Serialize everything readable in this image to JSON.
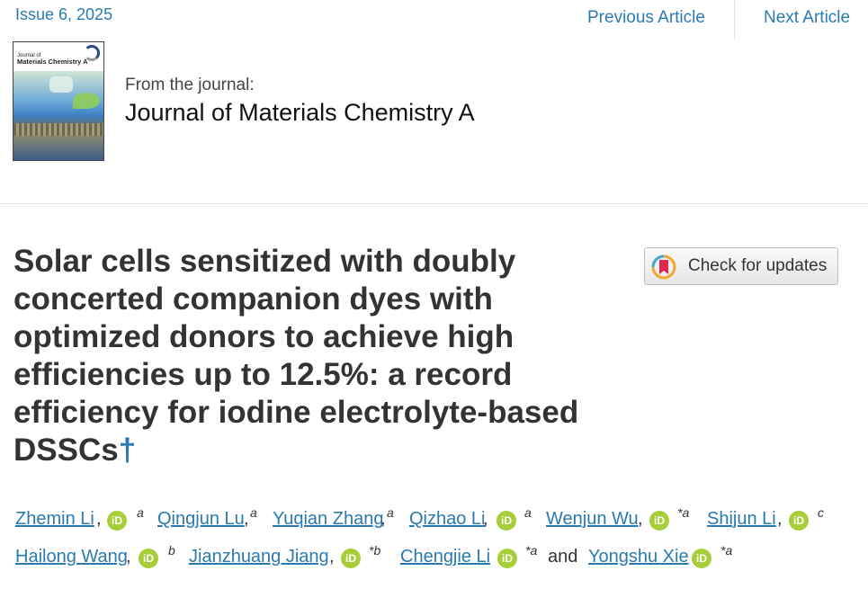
{
  "header": {
    "issue": "Issue 6, 2025",
    "prev_label": "Previous Article",
    "next_label": "Next Article"
  },
  "journal": {
    "cover_title_line1": "Journal of",
    "cover_title_line2": "Materials Chemistry A",
    "from_label": "From the journal:",
    "name": "Journal of Materials Chemistry A"
  },
  "article": {
    "title": "Solar cells sensitized with doubly concerted companion dyes with optimized donors to achieve high efficiencies up to 12.5%: a record efficiency for iodine electrolyte-based DSSCs",
    "dagger": "†",
    "check_updates_label": "Check for updates"
  },
  "authors": [
    {
      "name": "Zhemin Li",
      "sep": ",",
      "orcid_text": "iD",
      "sup": "a"
    },
    {
      "name": "Qingjun Lu",
      "sep": ",",
      "sup": "a"
    },
    {
      "name": "Yuqian Zhang",
      "sep": ",",
      "sup": "a"
    },
    {
      "name": "Qizhao Li",
      "sep": ",",
      "orcid_text": "iD",
      "sup": "a"
    },
    {
      "name": "Wenjun Wu",
      "sep": ",",
      "orcid_text": "iD",
      "sup": "*a"
    },
    {
      "name": "Shijun Li",
      "sep": ",",
      "orcid_text": "iD",
      "sup": "c"
    },
    {
      "name": "Hailong Wang",
      "sep": ",",
      "orcid_text": "iD",
      "sup": "b"
    },
    {
      "name": "Jianzhuang Jiang",
      "sep": ",",
      "orcid_text": "iD",
      "sup": "*b"
    },
    {
      "name": "Chengjie Li",
      "orcid_text": "iD",
      "sup": "*a"
    },
    {
      "name": "Yongshu Xie",
      "orcid_text": "iD",
      "sup": "*a"
    }
  ],
  "authors_and": "and",
  "colors": {
    "link": "#2a7ab0",
    "orcid": "#a6ce39",
    "text": "#333333"
  }
}
